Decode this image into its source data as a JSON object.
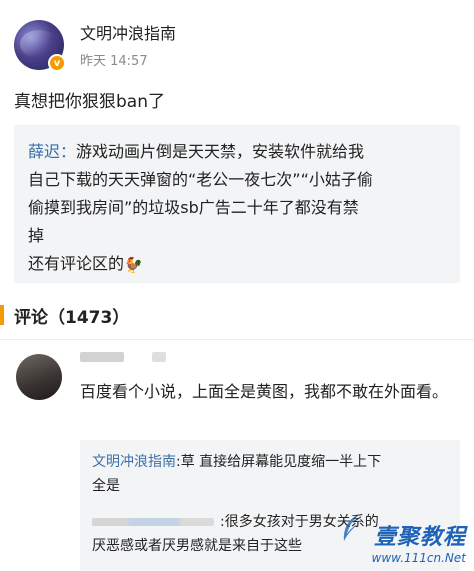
{
  "post": {
    "author": "文明冲浪指南",
    "time": "昨天 14:57",
    "badge_icon": "verified-v-icon",
    "text": "真想把你狠狠ban了"
  },
  "quote": {
    "name": "薛迟：",
    "lines": [
      "游戏动画片倒是天天禁，安装软件就给我",
      "自己下载的天天弹窗的“老公一夜七次”“小姑子偷",
      "偷摸到我房间”的垃圾sb广告二十年了都没有禁",
      "掉",
      "还有评论区的"
    ],
    "emoji": "🐓"
  },
  "comments": {
    "header": "评论（1473）",
    "accent_color": "#f39b00",
    "first": {
      "text": "百度看个小说，上面全是黄图，我都不敢在外面看。",
      "reply": {
        "name": "文明冲浪指南",
        "line1_rest": ":草 直接给屏幕能见度缩一半上下",
        "line1b": "全是",
        "line2": ":很多女孩对于男女关系的",
        "line3": "厌恶感或者厌男感就是来自于这些"
      }
    }
  },
  "watermark": {
    "title": "壹聚教程",
    "url": "www.111cn.Net"
  }
}
